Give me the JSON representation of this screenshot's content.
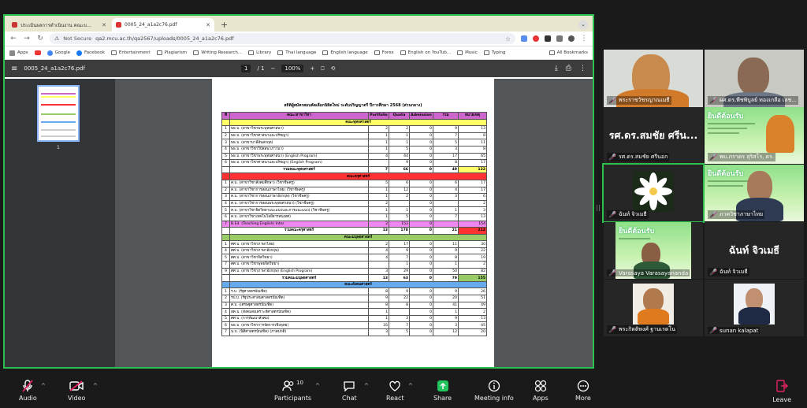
{
  "browser": {
    "tabs": [
      {
        "label": "ประเมินผลการดำเนินงาน คณะบ...",
        "active": false
      },
      {
        "label": "0005_24_a1a2c76.pdf",
        "active": true
      }
    ],
    "new_tab": "+",
    "security_label": "Not Secure",
    "url": "qa2.mcu.ac.th/qa2567/uploads/0005_24_a1a2c76.pdf",
    "bookmarks": [
      "Apps",
      "",
      "Google",
      "Facebook",
      "Entertainment",
      "Plagiarism",
      "Writing Research...",
      "Library",
      "Thai language",
      "English language",
      "Forex",
      "English on YouTub...",
      "Music",
      "Typing"
    ],
    "all_bookmarks": "All Bookmarks"
  },
  "pdf": {
    "filename": "0005_24_a1a2c76.pdf",
    "page_current": "1",
    "page_total": "/ 1",
    "zoom": "100%",
    "thumb_page_num": "1",
    "doc_title": "สถิติผู้สมัครสอบคัดเลือกนิสิตใหม่ ระดับปริญญาตรี ปีการศึกษา 2568 (ส่วนกลาง)",
    "header": [
      "ที่",
      "คณะ/สาขาวิชา",
      "Portfolio",
      "Quota",
      "Admission",
      "รวม",
      "หมายเหตุ"
    ],
    "rows": [
      {
        "kind": "sec",
        "color": "#ffff66",
        "cells": [
          "",
          "คณะพุทธศาสตร์",
          "",
          "",
          "",
          "",
          ""
        ]
      },
      {
        "kind": "row",
        "cells": [
          "1",
          "พธ.บ. (สาขาวิชาพระพุทธศาสนา)",
          "2",
          "2",
          "0",
          "9",
          "13"
        ]
      },
      {
        "kind": "row",
        "cells": [
          "2",
          "พธ.บ. (สาขาวิชาศาสนาและปรัชญา)",
          "1",
          "1",
          "0",
          "7",
          "8"
        ]
      },
      {
        "kind": "row",
        "cells": [
          "3",
          "พธ.บ. (สาขาบาลีสันสกฤต)",
          "1",
          "1",
          "0",
          "5",
          "11"
        ]
      },
      {
        "kind": "row",
        "cells": [
          "4",
          "พธ.บ. (สาขาวิชาวิปัสสนาภาวนา)",
          "1",
          "5",
          "0",
          "3",
          "8"
        ]
      },
      {
        "kind": "row",
        "cells": [
          "5",
          "พธ.บ. (สาขาวิชาพระพุทธศาสนา) (English Program)",
          "4",
          "44",
          "0",
          "17",
          "65"
        ]
      },
      {
        "kind": "row",
        "cells": [
          "6",
          "พธ.บ. (สาขาวิชาศาสนาและปรัชญา) (English Program)",
          "",
          "9",
          "0",
          "8",
          "17"
        ]
      },
      {
        "kind": "sum",
        "hl": "#ffff66",
        "cells": [
          "",
          "รวมคณะพุทธศาสตร์",
          "7",
          "66",
          "0",
          "49",
          "122"
        ]
      },
      {
        "kind": "sec",
        "color": "#ff3333",
        "cells": [
          "",
          "คณะครุศาสตร์",
          "",
          "",
          "",
          "",
          ""
        ]
      },
      {
        "kind": "row",
        "cells": [
          "1",
          "ค.บ. (สาขาวิชาสังคมศึกษา) (วิชาชีพครู)",
          "5",
          "6",
          "0",
          "6",
          "17"
        ]
      },
      {
        "kind": "row",
        "cells": [
          "2",
          "ค.บ. (สาขาวิชาการสอนภาษาไทย) (วิชาชีพครู)",
          "1",
          "12",
          "0",
          "4",
          "17"
        ]
      },
      {
        "kind": "row",
        "cells": [
          "3",
          "ค.บ. (สาขาวิชาการสอนภาษาอังกฤษ) (วิชาชีพครู)",
          "1",
          "2",
          "0",
          "3",
          "6"
        ]
      },
      {
        "kind": "row",
        "cells": [
          "4",
          "ค.บ. (สาขาวิชาการสอนพระพุทธศาสนา) (วิชาชีพครู)",
          "2",
          "",
          "0",
          "",
          "2"
        ]
      },
      {
        "kind": "row",
        "cells": [
          "5",
          "ค.บ. (สาขาวิชาจิตวิทยาแนะแนวและการแนะแนว) (วิชาชีพครู)",
          "1",
          "1",
          "0",
          "1",
          "3"
        ]
      },
      {
        "kind": "row",
        "cells": [
          "6",
          "ค.บ. (สาขาวิชาเทคโนโลยีสารสนเทศ)",
          "1",
          "5",
          "0",
          "7",
          "13"
        ]
      },
      {
        "kind": "row",
        "rowcolor": "#ee88ee",
        "cells": [
          "7",
          "B.Ed. (Teaching English) Inter",
          "2",
          "152",
          "0",
          "",
          "154"
        ]
      },
      {
        "kind": "sum",
        "hl": "#ff3333",
        "cells": [
          "",
          "รวมคณะครุศาสตร์",
          "13",
          "178",
          "0",
          "21",
          "212"
        ]
      },
      {
        "kind": "sec",
        "color": "#99cc66",
        "cells": [
          "",
          "คณะมนุษยศาสตร์",
          "",
          "",
          "",
          "",
          ""
        ]
      },
      {
        "kind": "row",
        "cells": [
          "1",
          "ศศ.บ. (สาขาวิชาภาษาไทย)",
          "2",
          "17",
          "0",
          "11",
          "30"
        ]
      },
      {
        "kind": "row",
        "cells": [
          "4",
          "ศศ.บ. (สาขาวิชาภาษาอังกฤษ)",
          "4",
          "9",
          "0",
          "9",
          "22"
        ]
      },
      {
        "kind": "row",
        "cells": [
          "5",
          "ศศ.บ. (สาขาวิชาจิตวิทยา)",
          "4",
          "7",
          "0",
          "8",
          "19"
        ]
      },
      {
        "kind": "row",
        "cells": [
          "7",
          "ศศ.บ. (สาขาวิชาพุทธจิตวิทยา)",
          "",
          "1",
          "0",
          "1",
          "2"
        ]
      },
      {
        "kind": "row",
        "cells": [
          "9",
          "ศศ.บ. (สาขาวิชาภาษาอังกฤษ) (English Program)",
          "3",
          "29",
          "0",
          "50",
          "82"
        ]
      },
      {
        "kind": "sum",
        "hl": "#99cc66",
        "cells": [
          "",
          "รวมคณะมนุษยศาสตร์",
          "13",
          "63",
          "0",
          "79",
          "155"
        ]
      },
      {
        "kind": "sec",
        "color": "#66aaee",
        "cells": [
          "",
          "คณะสังคมศาสตร์",
          "",
          "",
          "",
          "",
          ""
        ]
      },
      {
        "kind": "row",
        "cells": [
          "1",
          "ร.บ. (รัฐศาสตรบัณฑิต)",
          "8",
          "9",
          "0",
          "9",
          "26"
        ]
      },
      {
        "kind": "row",
        "cells": [
          "2",
          "รป.บ. (รัฐประศาสนศาสตรบัณฑิต)",
          "9",
          "22",
          "0",
          "20",
          "51"
        ]
      },
      {
        "kind": "row",
        "cells": [
          "3",
          "ศ.บ. (เศรษฐศาสตรบัณฑิต)",
          "8",
          "8",
          "0",
          "41",
          "49"
        ]
      },
      {
        "kind": "row",
        "cells": [
          "4",
          "สค.บ. (สังคมสงเคราะห์ศาสตรบัณฑิต)",
          "1",
          "",
          "0",
          "1",
          "2"
        ]
      },
      {
        "kind": "row",
        "cells": [
          "5",
          "ศศ.บ. (การพัฒนาสังคม)",
          "1",
          "3",
          "0",
          "9",
          "13"
        ]
      },
      {
        "kind": "row",
        "cells": [
          "6",
          "พธ.บ. (สาขาวิชาการจัดการเชิงพุทธ)",
          "35",
          "7",
          "0",
          "3",
          "45"
        ]
      },
      {
        "kind": "row",
        "cells": [
          "7",
          "น.บ. (นิติศาสตรบัณฑิต) (ภาคปกติ)",
          "3",
          "5",
          "0",
          "12",
          "20"
        ]
      }
    ]
  },
  "participants": [
    {
      "name": "พระราชวัชรญาณเมธี",
      "muted": true,
      "type": "monk-video"
    },
    {
      "name": "ผศ.ดร.พีชพิบูลย์ ทองเกลือ เลข...",
      "muted": true,
      "type": "man-video"
    },
    {
      "name": "รศ.ดร.สมชัย ศรีนอก",
      "big": "รศ.ดร.สมชัย ศรีน...",
      "muted": true,
      "type": "name-only"
    },
    {
      "name": "พม.ภราดร สุริสโร, ดร.",
      "muted": true,
      "type": "welcome"
    },
    {
      "name": "ฉันท์ จิวเมธี",
      "muted": true,
      "type": "lotus",
      "speaking": true
    },
    {
      "name": "ภาควิชาภาษาไทย",
      "muted": true,
      "type": "welcome-man"
    },
    {
      "name": "Varasaya Varasayananda",
      "muted": true,
      "type": "welcome-small"
    },
    {
      "name": "ฉันท์ จิวเมธี",
      "big": "ฉันท์ จิวเมธี",
      "muted": true,
      "type": "name-only"
    },
    {
      "name": "พระกิตติพงศ์ ฐานเรดโน",
      "muted": true,
      "type": "monk-photo"
    },
    {
      "name": "sunan kalapat",
      "muted": true,
      "type": "man-photo"
    }
  ],
  "welcome_text": "ยินดีต้อนรับ",
  "toolbar": {
    "audio": "Audio",
    "video": "Video",
    "participants": "Participants",
    "participants_count": "10",
    "chat": "Chat",
    "react": "React",
    "share": "Share",
    "meeting_info": "Meeting info",
    "apps": "Apps",
    "more": "More",
    "leave": "Leave"
  },
  "colors": {
    "speaker_green": "#2dbf4e",
    "mute_red": "#e0245e",
    "share_green": "#22c55e"
  }
}
